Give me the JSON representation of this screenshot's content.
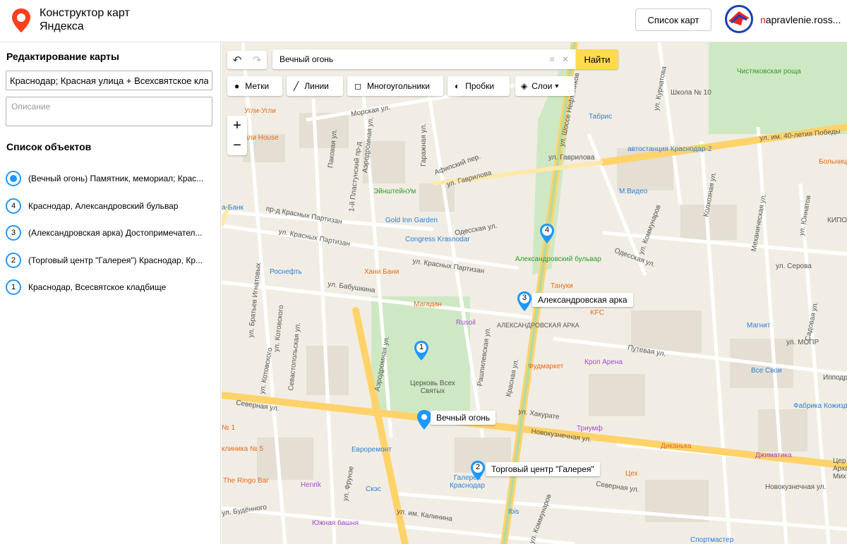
{
  "header": {
    "logo_line1": "Конструктор карт",
    "logo_line2": "Яндекса",
    "maps_button": "Список карт",
    "user_first": "n",
    "user_rest": "apravlenie.ross..."
  },
  "sidebar": {
    "title": "Редактирование карты",
    "map_name": "Краснодар; Красная улица + Всехсвятское кладб",
    "description_placeholder": "Описание",
    "objects_title": "Список объектов",
    "objects": [
      {
        "marker": "",
        "label": "(Вечный огонь) Памятник, мемориал; Крас..."
      },
      {
        "marker": "4",
        "label": "Краснодар, Александровский бульвар"
      },
      {
        "marker": "3",
        "label": "(Александровская арка) Достопримечател..."
      },
      {
        "marker": "2",
        "label": "(Торговый центр \"Галерея\") Краснодар, Кр..."
      },
      {
        "marker": "1",
        "label": "Краснодар, Всесвятское кладбище"
      }
    ]
  },
  "map": {
    "search_value": "Вечный огонь",
    "search_button": "Найти",
    "tools": {
      "marks": "Метки",
      "lines": "Линии",
      "polygons": "Многоугольники",
      "traffic": "Пробки",
      "layers": "Слои"
    },
    "zoom_in": "+",
    "zoom_out": "−",
    "pins": {
      "fire": "Вечный огонь",
      "arch": "Александровская арка",
      "gallery": "Торговый центр \"Галерея\"",
      "p1": "1",
      "p2": "2",
      "p3": "3",
      "p4": "4"
    },
    "streets": {
      "s1": "Морская ул.",
      "s2": "ул. Гаврилова",
      "s3": "пр-д Красных Партизан",
      "s4": "ул. Красных Партизан",
      "s5": "ул. Красных Партизан",
      "s6": "ул. Бабушкина",
      "s7": "Северная ул.",
      "s8": "Северная ул.",
      "s9": "ул. Хакурате",
      "s10": "Новокузнечная ул.",
      "s11": "ул. им. Калинина",
      "s12": "Красная ул.",
      "s13": "Рашпилевская ул.",
      "s14": "ул. Шоссе Нефтяников",
      "s15": "ул. Коммунаров",
      "s16": "Одесская ул.",
      "s17": "Путевая ул.",
      "s18": "ул. Серова",
      "s19": "ул. им. 40-летия Победы",
      "s20": "Садовая ул.",
      "s21": "ул. Котовского",
      "s22": "Севастопольская ул.",
      "s23": "ул. Братьев Игнатовых",
      "s24": "Аэродромная ул.",
      "s25": "ул. Будённого",
      "s26": "Колхозная ул.",
      "s27": "Механическая ул.",
      "s28": "ул. Юннатов",
      "s29": "ул. Курчатова",
      "s30": "Афипский пер.",
      "s31": "Новокузнечная ул.",
      "s32": "ул. МОПР",
      "s33": "1-й Пластунский пр-д",
      "s34": "Паковая ул.",
      "s35": "Аэродромная ул.",
      "s36": "Гаражная ул.",
      "s37": "ул. Фрунзе",
      "s38": "ул. Коммунаров"
    },
    "pois": {
      "tabris": "Табрис",
      "avtostanciya": "автостанция Краснодар-2",
      "mvideo": "М.Видео",
      "shkola": "Школа № 10",
      "chistyak": "Чистяковская роща",
      "bolnica": "Больница скорой помо",
      "einstein": "ЭйнштейнУм",
      "goldinn": "Gold Inn Garden",
      "congress": "Congress Krasnodar",
      "hani": "Хани Бани",
      "rosneft": "Роснефть",
      "magadan": "Магадан",
      "rusoil": "Rusoil",
      "alexbul": "Александровский бульвар",
      "tanuki": "Тануки",
      "kfc": "KFC",
      "alexarka": "АЛЕКСАНДРОВСКАЯ АРКА",
      "fudmarket": "Фудмаркет",
      "krop": "Кроп Арена",
      "magnit": "Магнит",
      "vsesvoi": "Все Свои",
      "fabrika": "Фабрика Кожизделий",
      "tserkov": "Церковь Всех Святых",
      "evroremont": "Евроремонт",
      "triumf": "Триумф",
      "dikanka": "Диканька",
      "dzhimatika": "Джиматика",
      "tseh": "Цех",
      "henrik": "Henrik",
      "skz": "Скэс",
      "ringo": "The Ringo Bar",
      "galereya": "Галерея Краснодар",
      "ibis": "Ibis",
      "yuzhnaya": "Южная башня",
      "sportmaster": "Спортмастер",
      "ugli": "Угли-Угли",
      "house": "али House",
      "bank": "а-Банк",
      "klinika": "клиника № 5",
      "kipo": "КИПО",
      "tser2": "Цер Арха Мих",
      "ippod": "Ипподр",
      "p1": "№ 1"
    }
  },
  "colors": {
    "accent": "#1e98ff",
    "search_btn": "#ffdb4d",
    "map_bg": "#f1ede4",
    "park": "#cfe8c4",
    "road": "#ffd36a"
  }
}
